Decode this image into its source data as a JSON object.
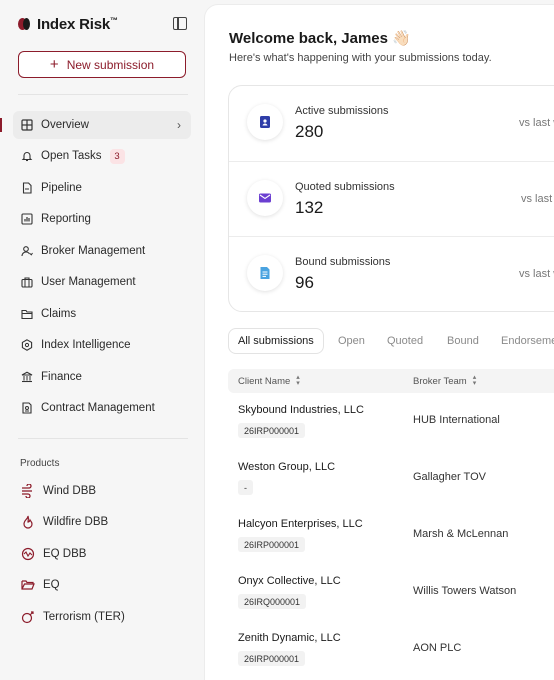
{
  "brand": {
    "name": "Index Risk",
    "mark": "™"
  },
  "sidebar": {
    "new_button": "New submission",
    "nav": [
      {
        "label": "Overview",
        "icon": "grid-icon"
      },
      {
        "label": "Open Tasks",
        "icon": "bell-icon",
        "badge": "3"
      },
      {
        "label": "Pipeline",
        "icon": "file-icon"
      },
      {
        "label": "Reporting",
        "icon": "chart-icon"
      },
      {
        "label": "Broker Management",
        "icon": "user-icon"
      },
      {
        "label": "User Management",
        "icon": "briefcase-icon"
      },
      {
        "label": "Claims",
        "icon": "folder-icon"
      },
      {
        "label": "Index Intelligence",
        "icon": "hexagon-icon"
      },
      {
        "label": "Finance",
        "icon": "bank-icon"
      },
      {
        "label": "Contract Management",
        "icon": "contract-icon"
      }
    ],
    "products_label": "Products",
    "products": [
      {
        "label": "Wind DBB",
        "icon": "wind-icon"
      },
      {
        "label": "Wildfire DBB",
        "icon": "flame-icon"
      },
      {
        "label": "EQ DBB",
        "icon": "quake-icon"
      },
      {
        "label": "EQ",
        "icon": "folder-open-icon"
      },
      {
        "label": "Terrorism (TER)",
        "icon": "target-icon"
      }
    ]
  },
  "header": {
    "welcome": "Welcome back, James 👋🏻",
    "subtitle": "Here's what's happening with your submissions today."
  },
  "stats": [
    {
      "label": "Active submissions",
      "value": "280",
      "vs": "vs last w",
      "icon": "doc-user-icon",
      "color": "#2f3ea8"
    },
    {
      "label": "Quoted submissions",
      "value": "132",
      "vs": "vs last",
      "icon": "mail-icon",
      "color": "#6b3fd1"
    },
    {
      "label": "Bound submissions",
      "value": "96",
      "vs": "vs last w",
      "icon": "document-icon",
      "color": "#4aa3e0"
    }
  ],
  "tabs": [
    "All submissions",
    "Open",
    "Quoted",
    "Bound",
    "Endorseme"
  ],
  "table": {
    "columns": [
      "Client Name",
      "Broker Team"
    ],
    "rows": [
      {
        "client": "Skybound Industries, LLC",
        "ref": "26IRP000001",
        "broker": "HUB International"
      },
      {
        "client": "Weston Group, LLC",
        "ref": "-",
        "broker": "Gallagher TOV"
      },
      {
        "client": "Halcyon Enterprises, LLC",
        "ref": "26IRP000001",
        "broker": "Marsh & McLennan"
      },
      {
        "client": "Onyx Collective, LLC",
        "ref": "26IRQ000001",
        "broker": "Willis Towers Watson"
      },
      {
        "client": "Zenith Dynamic, LLC",
        "ref": "26IRP000001",
        "broker": "AON PLC"
      }
    ]
  },
  "colors": {
    "brand": "#8c1c2b",
    "badge_bg": "#fbe3e5"
  }
}
